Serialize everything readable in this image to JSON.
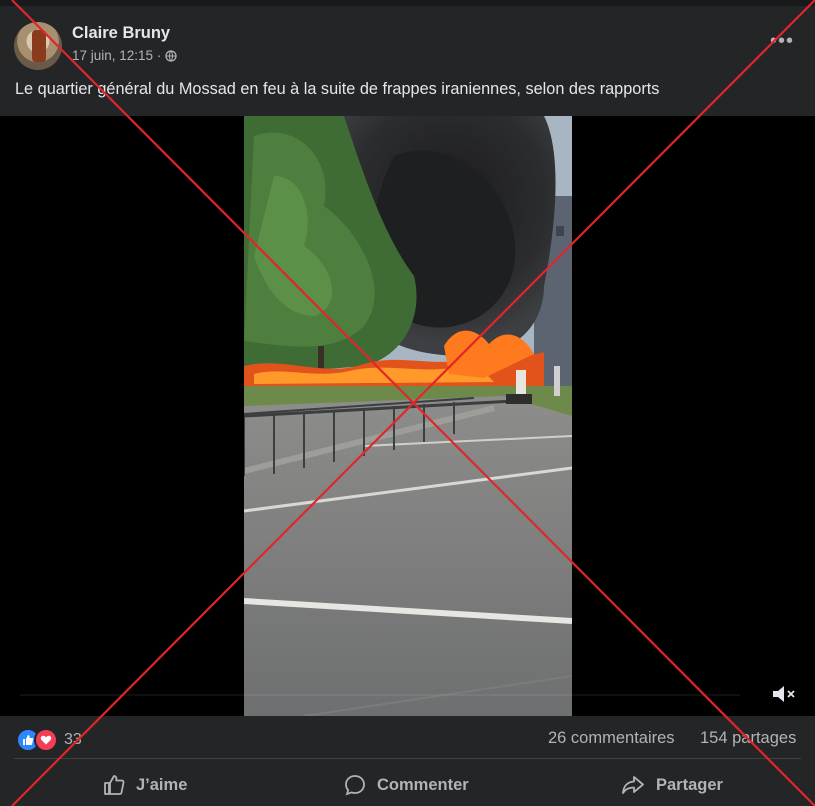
{
  "post": {
    "author": "Claire Bruny",
    "timestamp": "17 juin, 12:15 ·",
    "privacy_icon": "globe-icon",
    "more_icon": "•••",
    "caption": "Le quartier général du Mossad en feu à la suite de frappes iraniennes, selon des rapports"
  },
  "video": {
    "mute_icon": "speaker-muted-icon"
  },
  "stats": {
    "reactions": [
      "like",
      "love"
    ],
    "reaction_count": "33",
    "comments": "26 commentaires",
    "shares": "154 partages"
  },
  "actions": {
    "like": "J’aime",
    "comment": "Commenter",
    "share": "Partager"
  },
  "colors": {
    "background": "#242526",
    "text": "#e4e6eb",
    "secondary_text": "#b0b3b8",
    "like_blue": "#2d88ff",
    "love_red": "#f33e58",
    "overlay_cross": "#e0262b"
  }
}
